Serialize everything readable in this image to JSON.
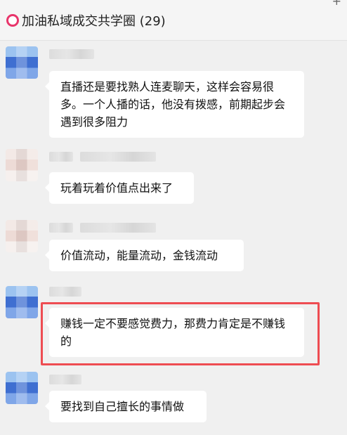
{
  "header": {
    "title": "加油私域成交共学圈 (29)",
    "icon": "ring-icon",
    "ring_color": "#e8356b",
    "menu_icon": "plus-icon"
  },
  "messages": [
    {
      "text": "直播还是要找熟人连麦聊天，这样会容易很多。一个人播的话，他没有拨感，前期起步会遇到很多阻力"
    },
    {
      "text": "玩着玩着价值点出来了"
    },
    {
      "text": "价值流动，能量流动，金钱流动"
    },
    {
      "text": "赚钱一定不要感觉费力，那费力肯定是不赚钱的",
      "highlighted": true,
      "highlight_color": "#ee4c52"
    },
    {
      "text": "要找到自己擅长的事情做"
    }
  ]
}
